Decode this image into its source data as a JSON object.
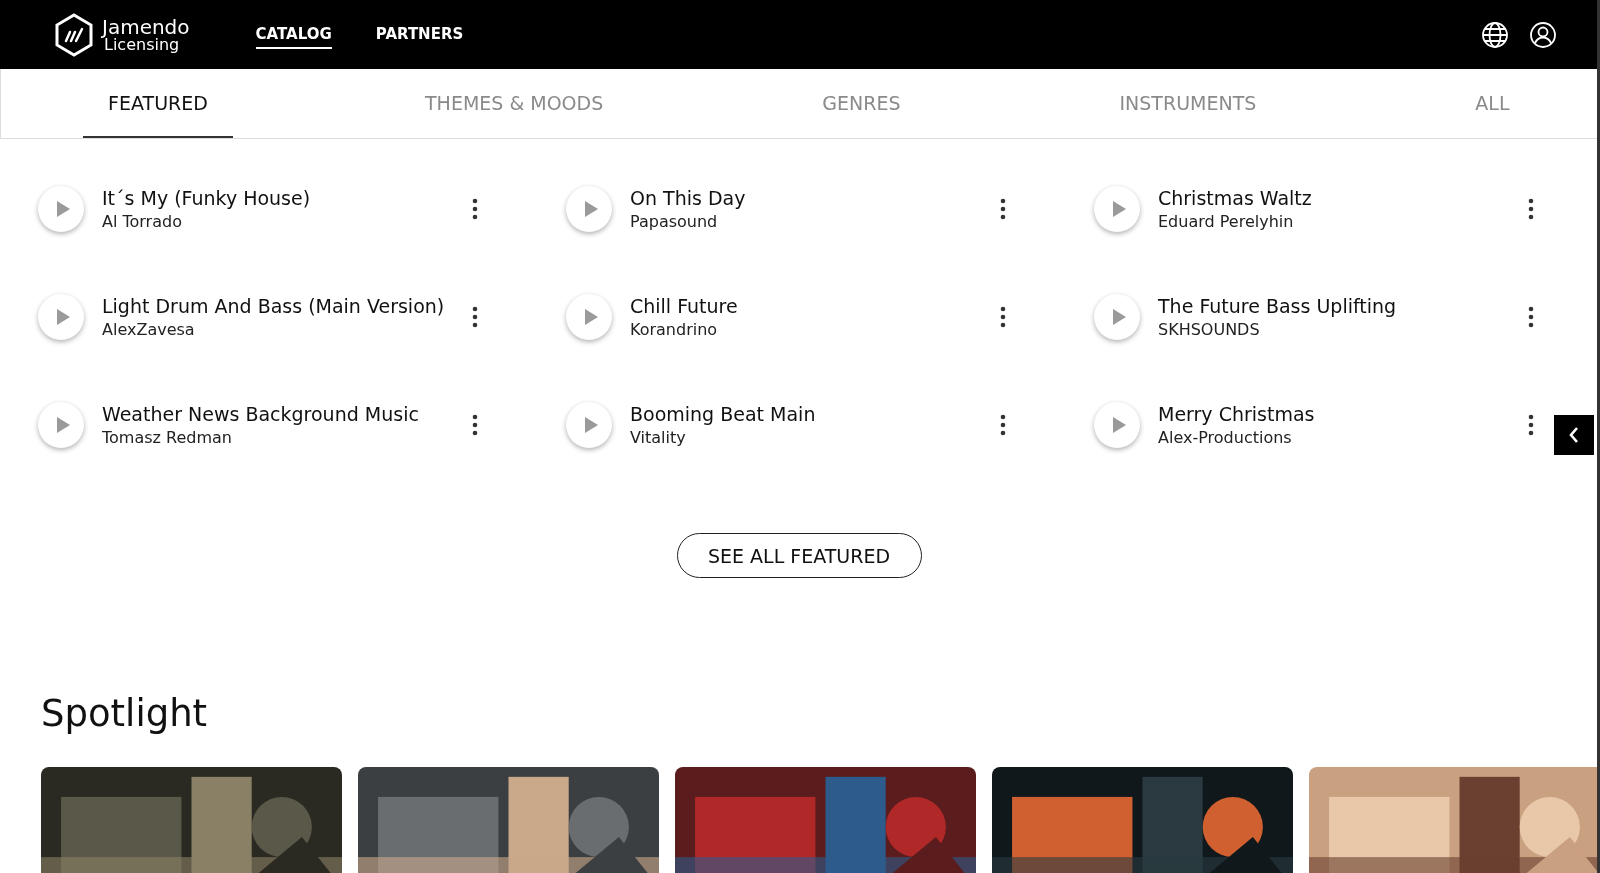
{
  "header": {
    "logo": {
      "line1": "Jamendo",
      "line2": "Licensing"
    },
    "nav": [
      {
        "label": "CATALOG",
        "selected": true
      },
      {
        "label": "PARTNERS",
        "selected": false
      }
    ]
  },
  "tabs": [
    {
      "label": "FEATURED",
      "selected": true
    },
    {
      "label": "THEMES & MOODS",
      "selected": false
    },
    {
      "label": "GENRES",
      "selected": false
    },
    {
      "label": "INSTRUMENTS",
      "selected": false
    },
    {
      "label": "ALL",
      "selected": false
    }
  ],
  "tracks": [
    {
      "title": "It´s My (Funky House)",
      "artist": "Al Torrado"
    },
    {
      "title": "On This Day",
      "artist": "Papasound"
    },
    {
      "title": "Christmas Waltz",
      "artist": "Eduard Perelyhin"
    },
    {
      "title": "Light Drum And Bass (Main Version)",
      "artist": "AlexZavesa"
    },
    {
      "title": "Chill Future",
      "artist": "Korandrino"
    },
    {
      "title": "The Future Bass Uplifting",
      "artist": "SKHSOUNDS"
    },
    {
      "title": "Weather News Background Music",
      "artist": "Tomasz Redman"
    },
    {
      "title": "Booming Beat Main",
      "artist": "Vitality"
    },
    {
      "title": "Merry Christmas",
      "artist": "Alex-Productions"
    }
  ],
  "see_all_button": "SEE ALL FEATURED",
  "spotlight": {
    "title": "Spotlight"
  }
}
